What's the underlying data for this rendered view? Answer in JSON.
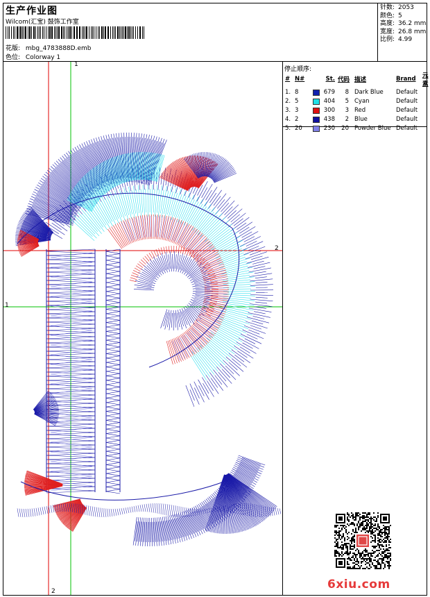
{
  "header": {
    "title": "生产作业图",
    "company": "Wilcom(汇宝) 鼓饰工作室",
    "design_label": "花版:",
    "design_value": "mbg_4783888D.emb",
    "colorway_label": "色位:",
    "colorway_value": "Colorway 1"
  },
  "stats": {
    "stitches_label": "针数:",
    "stitches": "2053",
    "colors_label": "颜色:",
    "colors": "5",
    "height_label": "高度:",
    "height": "36.2 mm",
    "width_label": "宽度:",
    "width": "26.8 mm",
    "scale_label": "比例:",
    "scale": "4.99"
  },
  "stop_sequence": {
    "title": "停止顺序:",
    "headers": [
      "#",
      "N#",
      "St.",
      "代码",
      "描述",
      "Brand",
      "元素"
    ],
    "rows": [
      {
        "idx": "1.",
        "n": "8",
        "color": "#1020b0",
        "st": "679",
        "code": "8",
        "desc": "Dark Blue",
        "brand": "Default"
      },
      {
        "idx": "2.",
        "n": "5",
        "color": "#20e0e8",
        "st": "404",
        "code": "5",
        "desc": "Cyan",
        "brand": "Default"
      },
      {
        "idx": "3.",
        "n": "3",
        "color": "#e01010",
        "st": "300",
        "code": "3",
        "desc": "Red",
        "brand": "Default"
      },
      {
        "idx": "4.",
        "n": "2",
        "color": "#1010a0",
        "st": "438",
        "code": "2",
        "desc": "Blue",
        "brand": "Default"
      },
      {
        "idx": "5.",
        "n": "20",
        "color": "#8080e8",
        "st": "230",
        "code": "20",
        "desc": "Powder Blue",
        "brand": "Default"
      }
    ]
  },
  "axes": {
    "top_1": "1",
    "right_2": "2",
    "left_1": "1",
    "bottom_2": "2"
  },
  "watermark": "6xiu.com",
  "colors": {
    "red_guide": "#e00000",
    "green_guide": "#00c000",
    "blue": "#1a1aa8",
    "cyan": "#30e0ee",
    "red": "#e02020",
    "powder": "#8c8ce8"
  }
}
